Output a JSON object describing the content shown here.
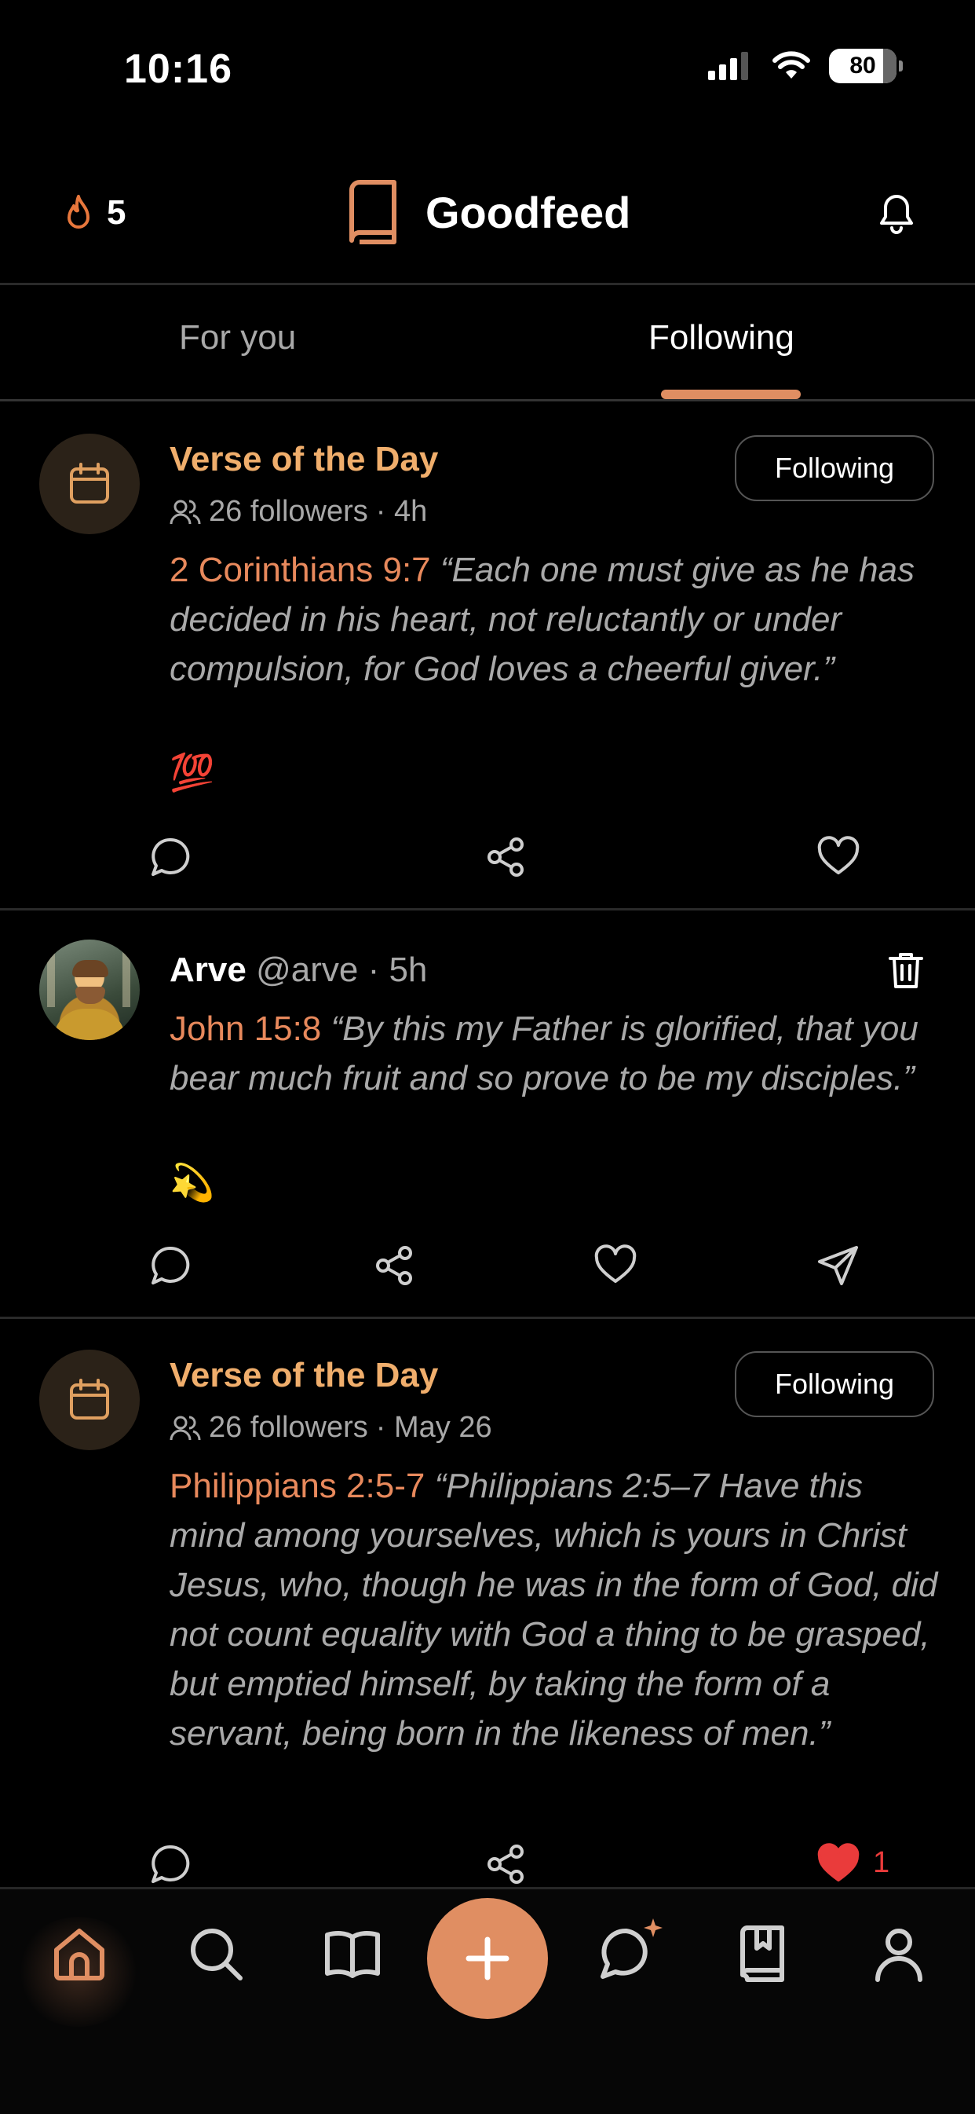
{
  "status_bar": {
    "time": "10:16",
    "battery": "80"
  },
  "header": {
    "streak_count": "5",
    "title": "Goodfeed"
  },
  "tabs": [
    {
      "label": "For you",
      "active": false
    },
    {
      "label": "Following",
      "active": true
    }
  ],
  "posts": [
    {
      "type": "verse_of_the_day",
      "title": "Verse of the Day",
      "followers": "26 followers",
      "time": "· 4h",
      "follow_label": "Following",
      "reference": "2 Corinthians 9:7",
      "text": "“Each one must give as he has decided in his heart, not reluctantly or under compulsion, for God loves a cheerful giver.”",
      "emoji": "💯",
      "liked": false
    },
    {
      "type": "user_post",
      "author_name": "Arve",
      "author_handle": "@arve · 5h",
      "reference": "John 15:8",
      "text": "“By this my Father is glorified, that you bear much fruit and so prove to be my disciples.”",
      "emoji": "💫",
      "liked": false
    },
    {
      "type": "verse_of_the_day",
      "title": "Verse of the Day",
      "followers": "26 followers",
      "time": "· May 26",
      "follow_label": "Following",
      "reference": "Philippians 2:5-7",
      "text": "“Philippians 2:5–7 Have this mind among yourselves, which is yours in Christ Jesus, who, though he was in the form of God, did not count equality with God a thing to be grasped, but emptied himself, by taking the form of a servant, being born in the likeness of men.”",
      "like_count": "1",
      "liked": true
    }
  ],
  "bottom_nav": [
    "home-icon",
    "search-icon",
    "bible-icon",
    "add-icon",
    "chat-sparkle-icon",
    "bookmark-book-icon",
    "profile-icon"
  ],
  "colors": {
    "accent": "#e08e62",
    "title_gold": "#f0ae6c",
    "reference": "#e8895c",
    "like_red": "#ea3b3b",
    "background": "#000000"
  }
}
